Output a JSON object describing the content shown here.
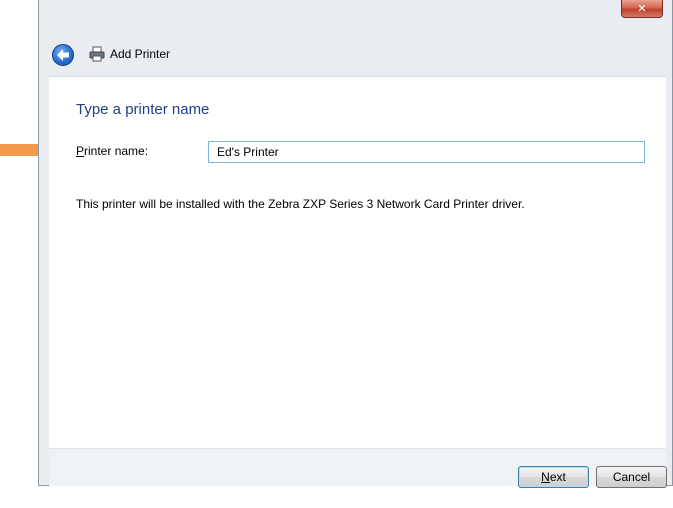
{
  "window": {
    "title": "Add Printer",
    "close_glyph": "✕"
  },
  "page": {
    "heading": "Type a printer name",
    "printer_name_label_mnemonic": "P",
    "printer_name_label_rest": "rinter name:",
    "printer_name_value": "Ed's Printer",
    "info": "This printer will be installed with the Zebra ZXP Series 3 Network Card Printer driver."
  },
  "buttons": {
    "next_mnemonic": "N",
    "next_rest": "ext",
    "cancel": "Cancel"
  },
  "icons": [
    "arrow-right-annotation-icon",
    "back-arrow-icon",
    "printer-icon",
    "close-icon"
  ],
  "colors": {
    "annotation_arrow": "#f39a4a",
    "heading": "#1f3f8c",
    "close_button": "#c9503a"
  }
}
